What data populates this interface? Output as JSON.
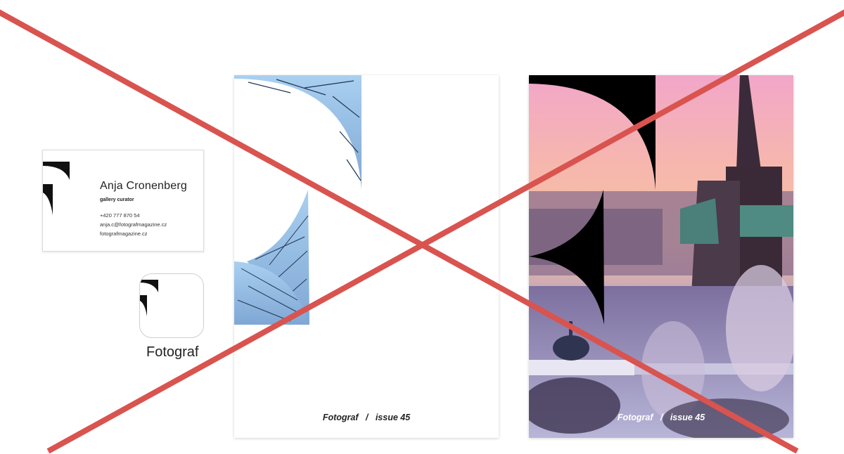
{
  "card": {
    "name": "Anja Cronenberg",
    "role": "gallery curator",
    "phone": "+420 777 870 54",
    "email": "anja.c@fotografmagazine.cz",
    "website": "fotografmagazine.cz"
  },
  "app": {
    "name": "Fotograf"
  },
  "magazines": [
    {
      "brand": "Fotograf",
      "separator": "/",
      "issue": "issue 45"
    },
    {
      "brand": "Fotograf",
      "separator": "/",
      "issue": "issue 45"
    }
  ],
  "colors": {
    "cross": "#d9534f",
    "logo": "#111111",
    "sky_ice": "#9fc6ea"
  }
}
